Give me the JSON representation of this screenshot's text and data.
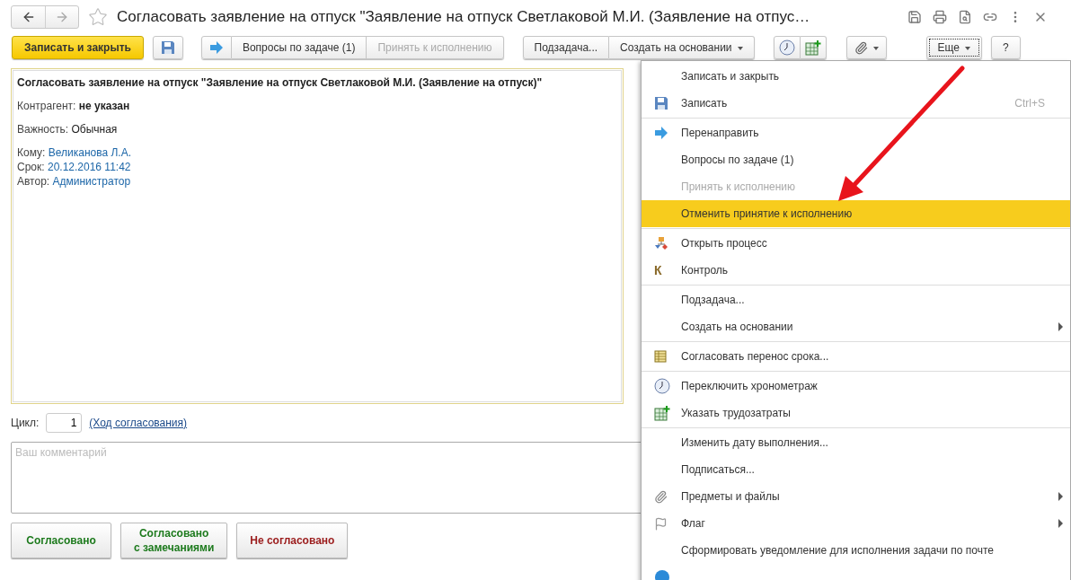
{
  "window": {
    "title": "Согласовать заявление на отпуск \"Заявление на отпуск Светлаковой М.И. (Заявление на отпус…"
  },
  "toolbar": [
    {
      "buttons": [
        {
          "kind": "primary",
          "label": "Записать и закрыть"
        }
      ]
    },
    {
      "buttons": [
        {
          "kind": "save"
        }
      ]
    },
    {
      "buttons": [
        {
          "kind": "forward"
        },
        {
          "kind": "text",
          "label": "Вопросы по задаче (1)",
          "disabled": false
        },
        {
          "kind": "text",
          "label": "Принять к исполнению",
          "disabled": true
        }
      ]
    },
    {
      "buttons": [
        {
          "kind": "text",
          "label": "Подзадача...",
          "disabled": false
        },
        {
          "kind": "text",
          "label": "Создать на основании",
          "disabled": false,
          "dropdown": true
        }
      ]
    },
    {
      "buttons": [
        {
          "kind": "clock"
        },
        {
          "kind": "add-table"
        }
      ]
    },
    {
      "buttons": [
        {
          "kind": "clip",
          "dropdown": true
        }
      ]
    },
    {
      "buttons": [
        {
          "kind": "text",
          "label": "Еще",
          "disabled": false,
          "dropdown": true,
          "focused": true
        }
      ]
    },
    {
      "buttons": [
        {
          "kind": "text",
          "label": "?",
          "disabled": false
        }
      ]
    }
  ],
  "task": {
    "heading": "Согласовать заявление на отпуск \"Заявление на отпуск Светлаковой М.И. (Заявление на отпуск)\"",
    "groups": [
      [
        {
          "label": "Контрагент:",
          "value": "не указан",
          "kind": "bold"
        }
      ],
      [
        {
          "label": "Важность:",
          "value": "Обычная",
          "kind": "plain"
        }
      ],
      [
        {
          "label": "Кому:",
          "value": "Великанова Л.А.",
          "kind": "link"
        },
        {
          "label": "Срок:",
          "value": "20.12.2016 11:42",
          "kind": "link"
        },
        {
          "label": "Автор:",
          "value": "Администратор",
          "kind": "link"
        }
      ]
    ]
  },
  "cycle": {
    "label": "Цикл:",
    "value": "1",
    "link": "(Ход согласования)"
  },
  "comment": {
    "placeholder": "Ваш комментарий"
  },
  "decisions": [
    {
      "label": "Согласовано",
      "color": "#1d7a1d"
    },
    {
      "label": "Согласовано\nс замечаниями",
      "color": "#1d7a1d"
    },
    {
      "label": "Не согласовано",
      "color": "#9b1c1c"
    }
  ],
  "menu": [
    [
      {
        "label": "Записать и закрыть",
        "kind": "plain",
        "disabled": false,
        "selected": false
      },
      {
        "label": "Записать",
        "kind": "save",
        "shortcut": "Ctrl+S",
        "disabled": false,
        "selected": false
      }
    ],
    [
      {
        "label": "Перенаправить",
        "kind": "forward",
        "disabled": false,
        "selected": false
      },
      {
        "label": "Вопросы по задаче (1)",
        "kind": "plain",
        "disabled": false,
        "selected": false
      },
      {
        "label": "Принять к исполнению",
        "kind": "plain",
        "disabled": true,
        "selected": false
      },
      {
        "label": "Отменить принятие к исполнению",
        "kind": "plain",
        "disabled": false,
        "selected": true
      }
    ],
    [
      {
        "label": "Открыть процесс",
        "kind": "process",
        "disabled": false,
        "selected": false
      },
      {
        "label": "Контроль",
        "kind": "letter",
        "glyph": "К",
        "disabled": false,
        "selected": false
      }
    ],
    [
      {
        "label": "Подзадача...",
        "kind": "plain",
        "disabled": false,
        "selected": false
      },
      {
        "label": "Создать на основании",
        "kind": "plain",
        "submenu": true,
        "disabled": false,
        "selected": false
      }
    ],
    [
      {
        "label": "Согласовать перенос срока...",
        "kind": "table",
        "disabled": false,
        "selected": false
      }
    ],
    [
      {
        "label": "Переключить хронометраж",
        "kind": "clock",
        "disabled": false,
        "selected": false
      },
      {
        "label": "Указать трудозатраты",
        "kind": "add-table",
        "disabled": false,
        "selected": false
      }
    ],
    [
      {
        "label": "Изменить дату выполнения...",
        "kind": "plain",
        "disabled": false,
        "selected": false
      },
      {
        "label": "Подписаться...",
        "kind": "plain",
        "disabled": false,
        "selected": false
      },
      {
        "label": "Предметы и файлы",
        "kind": "clip",
        "submenu": true,
        "disabled": false,
        "selected": false
      },
      {
        "label": "Флаг",
        "kind": "flag",
        "submenu": true,
        "disabled": false,
        "selected": false
      },
      {
        "label": "Сформировать уведомление для исполнения задачи по почте",
        "kind": "plain",
        "disabled": false,
        "selected": false
      },
      {
        "kind": "info",
        "disabled": false,
        "selected": false
      }
    ]
  ]
}
